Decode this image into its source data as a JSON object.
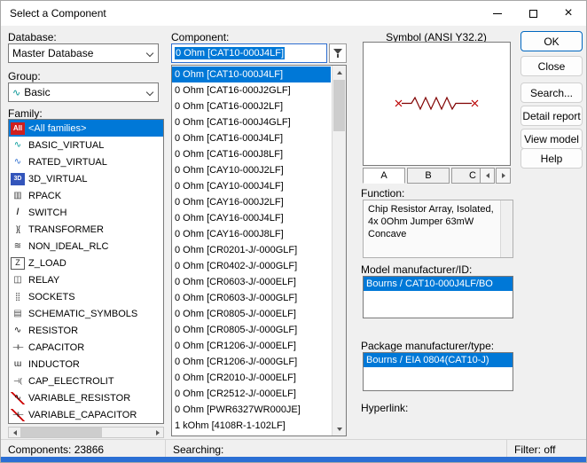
{
  "window": {
    "title": "Select a Component"
  },
  "icons": {
    "minimize": "minimize-icon",
    "maximize": "maximize-icon",
    "close": "close-icon",
    "database_dropdown": "chevron-down-icon",
    "group_dropdown": "chevron-down-icon",
    "group_value": "sine-wave-icon",
    "component_filter": "filter-funnel-icon",
    "scroll_up": "arrow-up-icon",
    "scroll_down": "arrow-down-icon",
    "section_prev": "arrow-left-icon",
    "section_next": "arrow-right-icon"
  },
  "database": {
    "label": "Database:",
    "value": "Master Database"
  },
  "group": {
    "label": "Group:",
    "value": "Basic"
  },
  "family": {
    "label": "Family:",
    "items": [
      {
        "icon": "all-families",
        "label": "<All families>",
        "selected": true
      },
      {
        "icon": "basic-virtual",
        "label": "BASIC_VIRTUAL"
      },
      {
        "icon": "rated-virtual",
        "label": "RATED_VIRTUAL"
      },
      {
        "icon": "3d-virtual",
        "label": "3D_VIRTUAL"
      },
      {
        "icon": "rpack",
        "label": "RPACK"
      },
      {
        "icon": "switch",
        "label": "SWITCH"
      },
      {
        "icon": "transformer",
        "label": "TRANSFORMER"
      },
      {
        "icon": "non-ideal-rlc",
        "label": "NON_IDEAL_RLC"
      },
      {
        "icon": "z-load",
        "label": "Z_LOAD"
      },
      {
        "icon": "relay",
        "label": "RELAY"
      },
      {
        "icon": "sockets",
        "label": "SOCKETS"
      },
      {
        "icon": "schematic-symbols",
        "label": "SCHEMATIC_SYMBOLS"
      },
      {
        "icon": "resistor",
        "label": "RESISTOR"
      },
      {
        "icon": "capacitor",
        "label": "CAPACITOR"
      },
      {
        "icon": "inductor",
        "label": "INDUCTOR"
      },
      {
        "icon": "cap-electrolit",
        "label": "CAP_ELECTROLIT"
      },
      {
        "icon": "variable-resistor",
        "label": "VARIABLE_RESISTOR"
      },
      {
        "icon": "variable-capacitor",
        "label": "VARIABLE_CAPACITOR"
      }
    ]
  },
  "component": {
    "label": "Component:",
    "filter_value": "0 Ohm [CAT10-000J4LF]",
    "items": [
      {
        "label": "0 Ohm [CAT10-000J4LF]",
        "selected": true
      },
      {
        "label": "0 Ohm [CAT16-000J2GLF]"
      },
      {
        "label": "0 Ohm [CAT16-000J2LF]"
      },
      {
        "label": "0 Ohm [CAT16-000J4GLF]"
      },
      {
        "label": "0 Ohm [CAT16-000J4LF]"
      },
      {
        "label": "0 Ohm [CAT16-000J8LF]"
      },
      {
        "label": "0 Ohm [CAY10-000J2LF]"
      },
      {
        "label": "0 Ohm [CAY10-000J4LF]"
      },
      {
        "label": "0 Ohm [CAY16-000J2LF]"
      },
      {
        "label": "0 Ohm [CAY16-000J4LF]"
      },
      {
        "label": "0 Ohm [CAY16-000J8LF]"
      },
      {
        "label": "0 Ohm [CR0201-J/-000GLF]"
      },
      {
        "label": "0 Ohm [CR0402-J/-000GLF]"
      },
      {
        "label": "0 Ohm [CR0603-J/-000ELF]"
      },
      {
        "label": "0 Ohm [CR0603-J/-000GLF]"
      },
      {
        "label": "0 Ohm [CR0805-J/-000ELF]"
      },
      {
        "label": "0 Ohm [CR0805-J/-000GLF]"
      },
      {
        "label": "0 Ohm [CR1206-J/-000ELF]"
      },
      {
        "label": "0 Ohm [CR1206-J/-000GLF]"
      },
      {
        "label": "0 Ohm [CR2010-J/-000ELF]"
      },
      {
        "label": "0 Ohm [CR2512-J/-000ELF]"
      },
      {
        "label": "0 Ohm [PWR6327WR000JE]"
      },
      {
        "label": "1 kOhm [4108R-1-102LF]"
      }
    ]
  },
  "symbol": {
    "label": "Symbol (ANSI Y32.2)",
    "tabs": [
      {
        "label": "A",
        "selected": true
      },
      {
        "label": "B"
      },
      {
        "label": "C"
      }
    ]
  },
  "function_info": {
    "label": "Function:",
    "text": "Chip Resistor Array, Isolated, 4x 0Ohm Jumper 63mW Concave"
  },
  "model": {
    "label": "Model manufacturer/ID:",
    "items": [
      {
        "label": "Bourns / CAT10-000J4LF/BO",
        "selected": true
      }
    ]
  },
  "package": {
    "label": "Package manufacturer/type:",
    "items": [
      {
        "label": "Bourns / EIA 0804(CAT10-J)",
        "selected": true
      }
    ]
  },
  "hyperlink": {
    "label": "Hyperlink:"
  },
  "actions": {
    "ok": "OK",
    "close": "Close",
    "search": "Search...",
    "detail_report": "Detail report",
    "view_model": "View model",
    "help": "Help"
  },
  "status": {
    "components": "Components: 23866",
    "searching": "Searching:",
    "filter": "Filter: off"
  },
  "colors": {
    "selection": "#0078d7",
    "ok_border": "#0067c0",
    "symbol_stroke": "#800000",
    "pin_marker": "#bb0000"
  }
}
